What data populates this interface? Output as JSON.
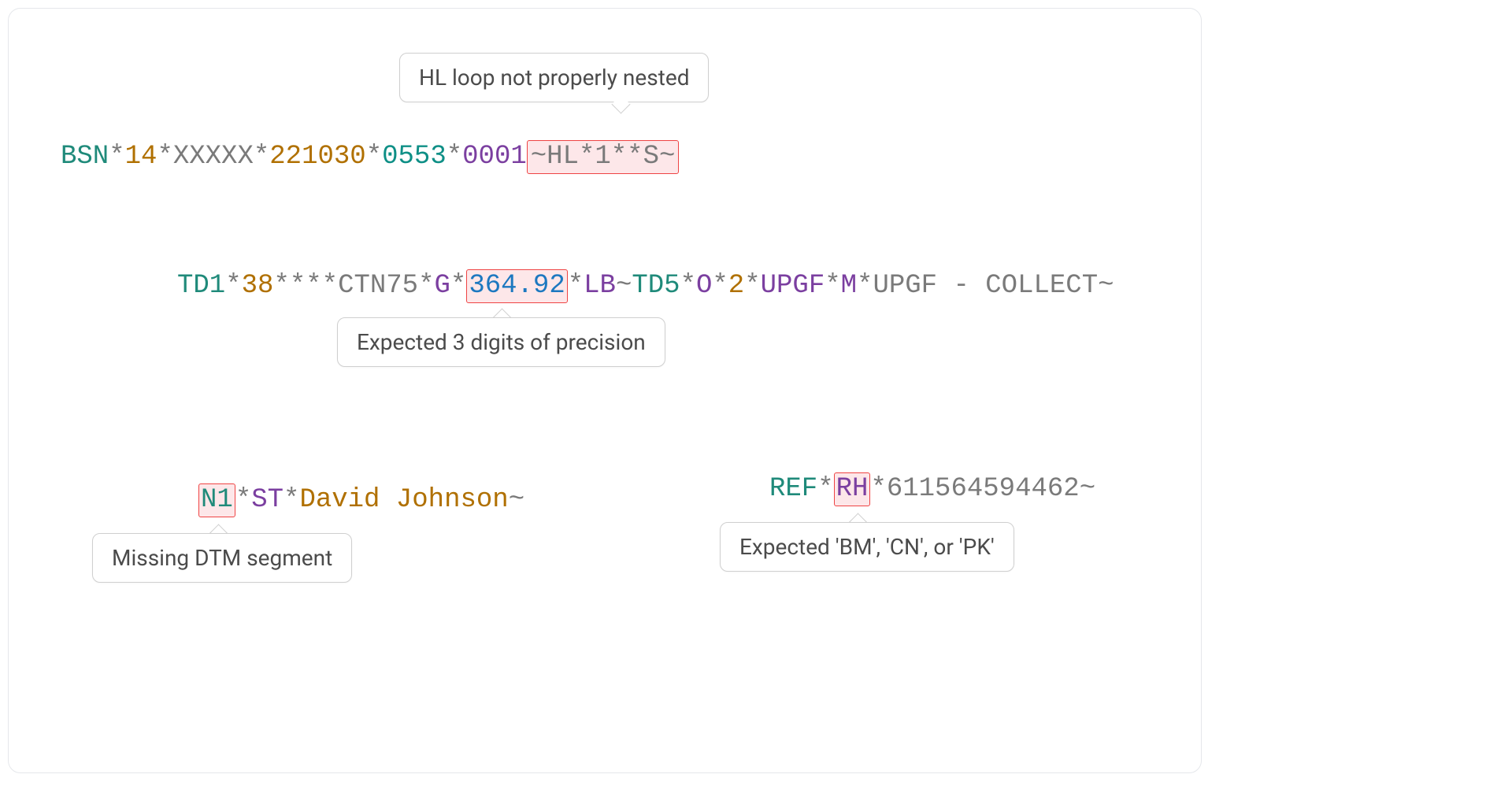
{
  "tooltips": {
    "hl_nested": "HL loop not properly nested",
    "precision": "Expected 3 digits of precision",
    "missing_dtm": "Missing DTM segment",
    "expected_codes": "Expected 'BM', 'CN', or 'PK'"
  },
  "line1": {
    "seg": "BSN",
    "d1": "*",
    "v1": "14",
    "d2": "*",
    "v2": "XXXXX",
    "d3": "*",
    "v3": "221030",
    "d4": "*",
    "v4": "0553",
    "d5": "*",
    "v5": "0001",
    "hl": "~HL*1**S~"
  },
  "line2": {
    "seg": "TD1",
    "d1": "*",
    "v1": "38",
    "d2": "****",
    "v2": "CTN75",
    "d3": "*",
    "v3": "G",
    "d4": "*",
    "val_hl": "364.92",
    "d5": "*",
    "v5": "LB",
    "t": "~",
    "seg2": "TD5",
    "d6": "*",
    "v6": "O",
    "d7": "*",
    "v7": "2",
    "d8": "*",
    "v8": "UPGF",
    "d9": "*",
    "v9": "M",
    "d10": "*",
    "v10": "UPGF - COLLECT",
    "t2": "~"
  },
  "line3": {
    "seg_hl": "N1",
    "d1": "*",
    "v1": "ST",
    "d2": "*",
    "name": "David Johnson",
    "t": "~"
  },
  "line4": {
    "seg": "REF",
    "d1": "*",
    "val_hl": "RH",
    "d2": "*",
    "v2": "611564594462",
    "t": "~"
  }
}
